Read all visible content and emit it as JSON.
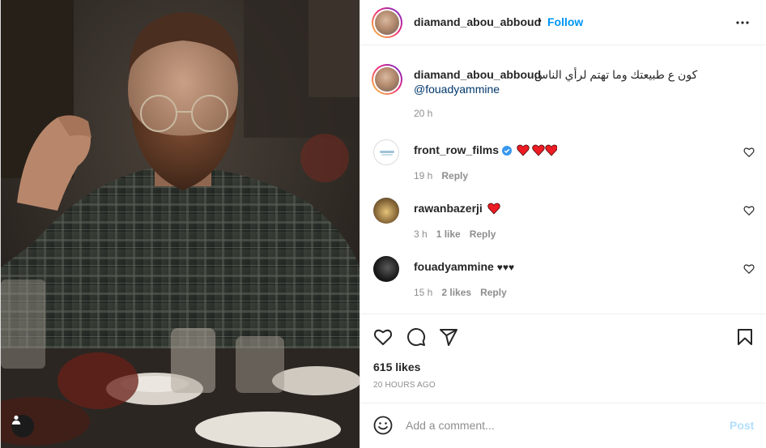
{
  "post": {
    "author": "diamand_abou_abboud",
    "follow_label": "Follow",
    "dot": "•",
    "caption_text": "كون ع طبيعتك وما تهتم لرأي الناس",
    "caption_mention": "@fouadyammine",
    "caption_time": "20 h"
  },
  "comments": [
    {
      "user": "front_row_films",
      "verified": true,
      "emoji": "❤❤❤",
      "time": "19 h",
      "likes": "",
      "reply": "Reply"
    },
    {
      "user": "rawanbazerji",
      "verified": false,
      "emoji": "❤",
      "time": "3 h",
      "likes": "1 like",
      "reply": "Reply"
    },
    {
      "user": "fouadyammine",
      "verified": false,
      "text": "♥♥♥",
      "time": "15 h",
      "likes": "2 likes",
      "reply": "Reply"
    }
  ],
  "stats": {
    "likes": "615 likes",
    "posted": "20 HOURS AGO"
  },
  "add_comment": {
    "placeholder": "Add a comment...",
    "post_label": "Post"
  },
  "colors": {
    "accent": "#0095f6",
    "post_disabled": "#b2dffc",
    "heart_red": "#ed4956",
    "verified_blue": "#3897f0"
  },
  "icons": {
    "header": [
      "more-options-icon"
    ],
    "actions": [
      "like-icon",
      "comment-icon",
      "share-icon",
      "save-icon"
    ],
    "media": [
      "user-tag-icon"
    ],
    "input": [
      "emoji-icon"
    ]
  }
}
